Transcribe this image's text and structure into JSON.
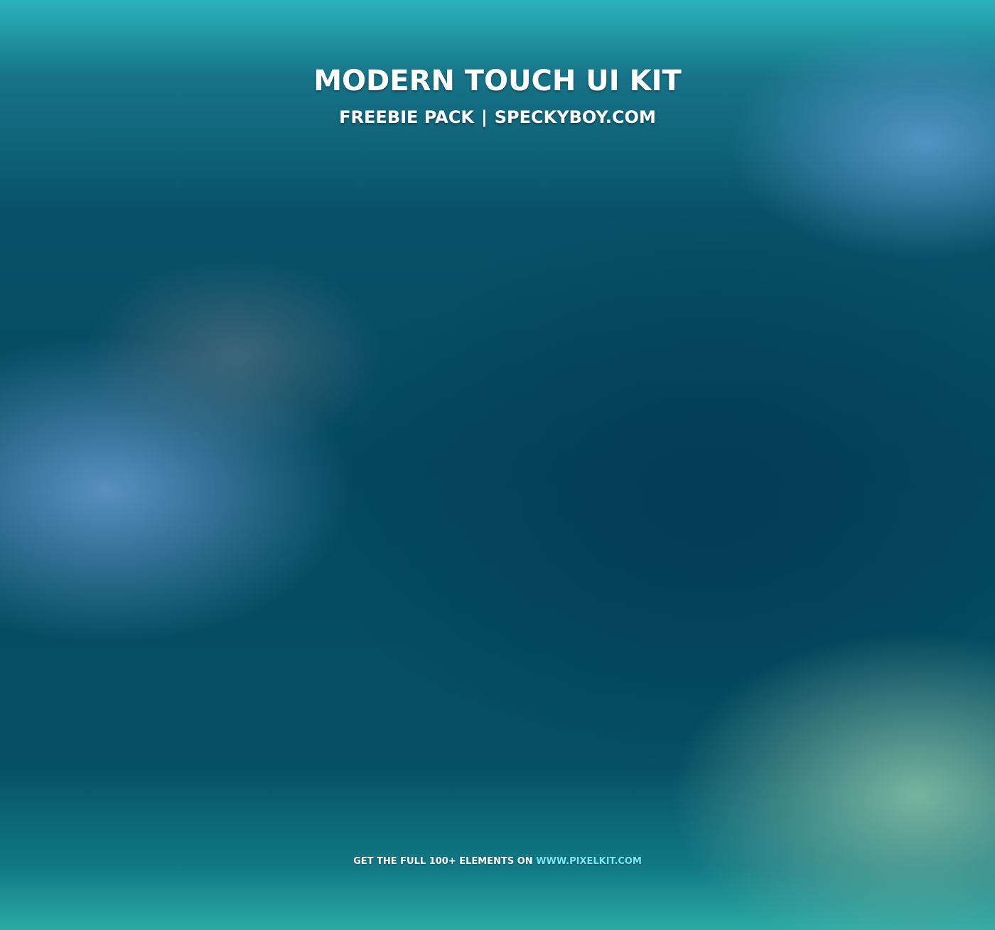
{
  "header": {
    "title": "MODERN TOUCH UI KIT",
    "subtitle_left": "FREEBIE PACK",
    "separator": "|",
    "subtitle_right": "SPECKYBOY.COM"
  },
  "footer": {
    "text": "GET THE FULL 100+ ELEMENTS ON ",
    "link": "WWW.PIXELKIT.COM",
    "link_color": "#7fe6f2"
  },
  "colors": {
    "background_dark": "#05495f",
    "background_light_top": "#2ab2bc",
    "background_light_bottom": "#2caaa5",
    "text": "#ffffff"
  }
}
